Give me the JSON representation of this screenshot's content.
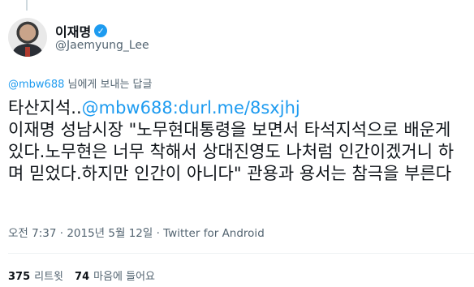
{
  "author": {
    "display_name": "이재명",
    "handle": "@Jaemyung_Lee",
    "verified_mark": "✓"
  },
  "reply": {
    "mention": "@mbw688",
    "suffix": " 님에게 보내는 답글"
  },
  "tweet": {
    "prefix": "타산지석..",
    "mention": "@mbw688",
    "colon": ":",
    "link": "durl.me/8sxjhj",
    "body": "이재명 성남시장 \"노무현대통령을 보면서 타석지석으로 배운게 있다.노무현은 너무 착해서 상대진영도 나처럼 인간이겠거니 하며 믿었다.하지만 인간이 아니다\" 관용과 용서는 참극을 부른다"
  },
  "meta": {
    "time": "오전 7:37",
    "sep1": " · ",
    "date": "2015년 5월 12일",
    "sep2": " · ",
    "source": "Twitter for Android"
  },
  "stats": {
    "retweets_count": "375",
    "retweets_label": "리트윗",
    "likes_count": "74",
    "likes_label": "마음에 들어요"
  },
  "colors": {
    "accent": "#1d9bf0",
    "text": "#0f1419",
    "muted": "#536471"
  }
}
